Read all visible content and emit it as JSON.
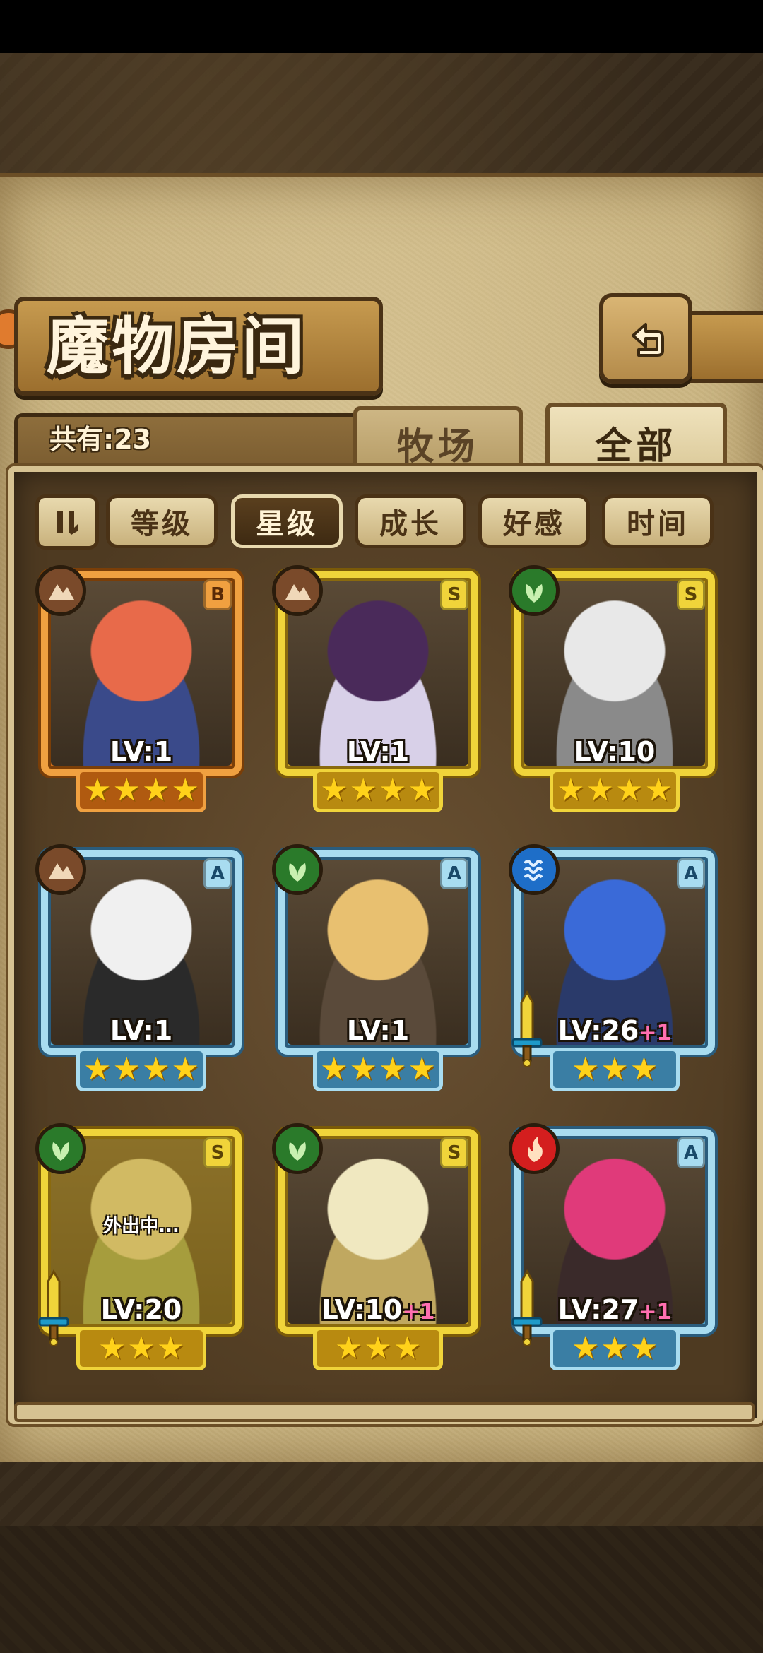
{
  "header": {
    "title": "魔物房间",
    "count_label": "共有:23"
  },
  "tabs": [
    {
      "label": "牧场",
      "active": false
    },
    {
      "label": "全部",
      "active": true
    }
  ],
  "sort": {
    "buttons": [
      {
        "label": "等级",
        "active": false
      },
      {
        "label": "星级",
        "active": true
      },
      {
        "label": "成长",
        "active": false
      },
      {
        "label": "好感",
        "active": false
      },
      {
        "label": "时间",
        "active": false
      }
    ]
  },
  "monsters": [
    {
      "rank": "B",
      "element": "earth",
      "level": "LV:1",
      "plus": "",
      "stars": 4,
      "frame": "orange",
      "status": "",
      "weapon": false
    },
    {
      "rank": "S",
      "element": "earth",
      "level": "LV:1",
      "plus": "",
      "stars": 4,
      "frame": "gold",
      "status": "",
      "weapon": false
    },
    {
      "rank": "S",
      "element": "wood",
      "level": "LV:10",
      "plus": "",
      "stars": 4,
      "frame": "gold",
      "status": "",
      "weapon": false
    },
    {
      "rank": "A",
      "element": "earth",
      "level": "LV:1",
      "plus": "",
      "stars": 4,
      "frame": "blue",
      "status": "",
      "weapon": false
    },
    {
      "rank": "A",
      "element": "wood",
      "level": "LV:1",
      "plus": "",
      "stars": 4,
      "frame": "blue",
      "status": "",
      "weapon": false
    },
    {
      "rank": "A",
      "element": "water",
      "level": "LV:26",
      "plus": "+1",
      "stars": 3,
      "frame": "blue",
      "status": "",
      "weapon": true
    },
    {
      "rank": "S",
      "element": "wood",
      "level": "LV:20",
      "plus": "",
      "stars": 3,
      "frame": "gold",
      "status": "外出中...",
      "weapon": true
    },
    {
      "rank": "S",
      "element": "wood",
      "level": "LV:10",
      "plus": "+1",
      "stars": 3,
      "frame": "gold",
      "status": "",
      "weapon": false
    },
    {
      "rank": "A",
      "element": "fire",
      "level": "LV:27",
      "plus": "+1",
      "stars": 3,
      "frame": "blue",
      "status": "",
      "weapon": true
    }
  ],
  "icons": {
    "back": "back-arrow-icon",
    "sort_toggle": "sort-order-icon",
    "elements": {
      "earth": "mountain-icon",
      "wood": "leaf-icon",
      "water": "wave-icon",
      "fire": "flame-icon"
    },
    "star": "star-icon",
    "weapon": "sword-icon"
  },
  "colors": {
    "gold_frame": "#f0d43a",
    "blue_frame": "#a8dcf0",
    "orange_frame": "#f0a040",
    "star": "#ffd21a",
    "plus": "#ff6fb0"
  }
}
